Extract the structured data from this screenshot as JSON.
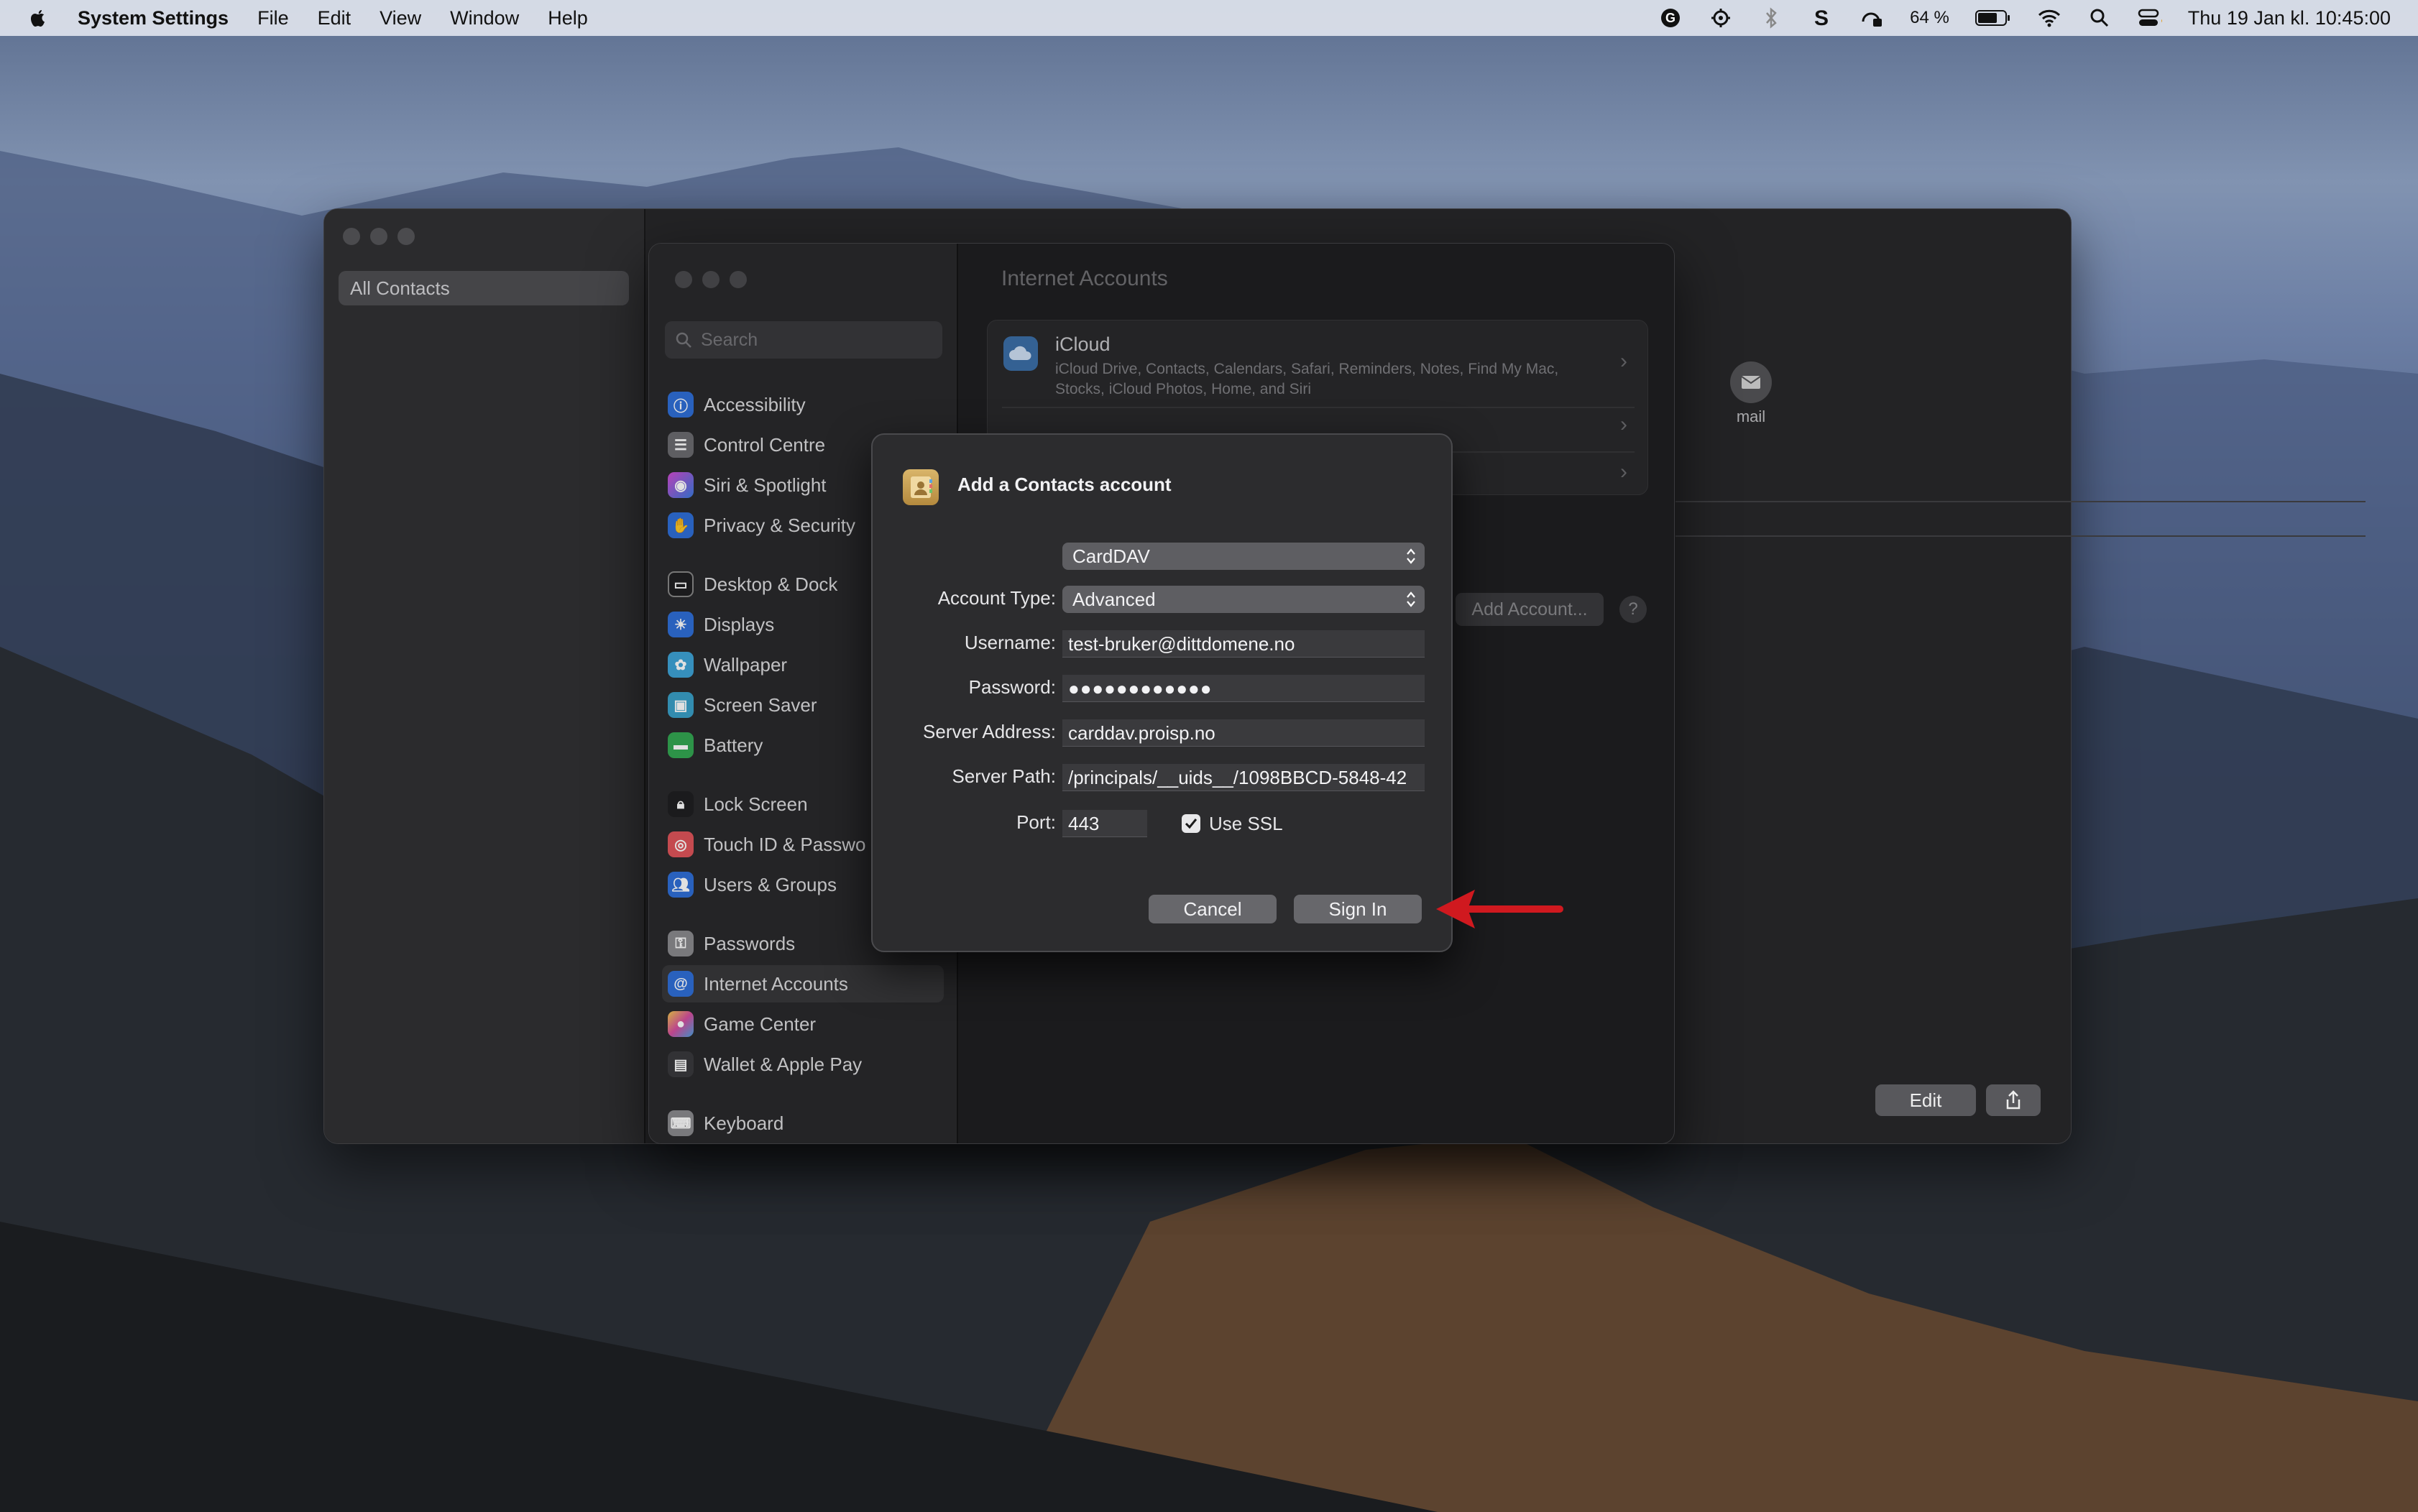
{
  "menubar": {
    "app_name": "System Settings",
    "menus": [
      "File",
      "Edit",
      "View",
      "Window",
      "Help"
    ],
    "battery": "64 %",
    "clock": "Thu 19 Jan kl. 10:45:00"
  },
  "contacts": {
    "sidebar_item": "All Contacts",
    "avatar_label": "mail",
    "edit_label": "Edit"
  },
  "settings": {
    "search_placeholder": "Search",
    "sidebar": [
      "Accessibility",
      "Control Centre",
      "Siri & Spotlight",
      "Privacy & Security",
      "Desktop & Dock",
      "Displays",
      "Wallpaper",
      "Screen Saver",
      "Battery",
      "Lock Screen",
      "Touch ID & Passwo",
      "Users & Groups",
      "Passwords",
      "Internet Accounts",
      "Game Center",
      "Wallet & Apple Pay",
      "Keyboard"
    ],
    "selected": "Internet Accounts",
    "pane_title": "Internet Accounts",
    "icloud": {
      "name": "iCloud",
      "description": "iCloud Drive, Contacts, Calendars, Safari, Reminders, Notes, Find My Mac, Stocks, iCloud Photos, Home, and Siri"
    },
    "add_account_label": "Add Account...",
    "help_label": "?"
  },
  "dialog": {
    "title": "Add a Contacts account",
    "protocol": "CardDAV",
    "account_type_label": "Account Type:",
    "account_type": "Advanced",
    "username_label": "Username:",
    "username": "test-bruker@dittdomene.no",
    "password_label": "Password:",
    "password": "●●●●●●●●●●●●",
    "server_address_label": "Server Address:",
    "server_address": "carddav.proisp.no",
    "server_path_label": "Server Path:",
    "server_path": "/principals/__uids__/1098BBCD-5848-42",
    "port_label": "Port:",
    "port": "443",
    "use_ssl_label": "Use SSL",
    "use_ssl": true,
    "cancel_label": "Cancel",
    "signin_label": "Sign In"
  },
  "colors": {
    "annotation_arrow": "#d0191f",
    "dialog_bg": "#2c2c2e"
  }
}
